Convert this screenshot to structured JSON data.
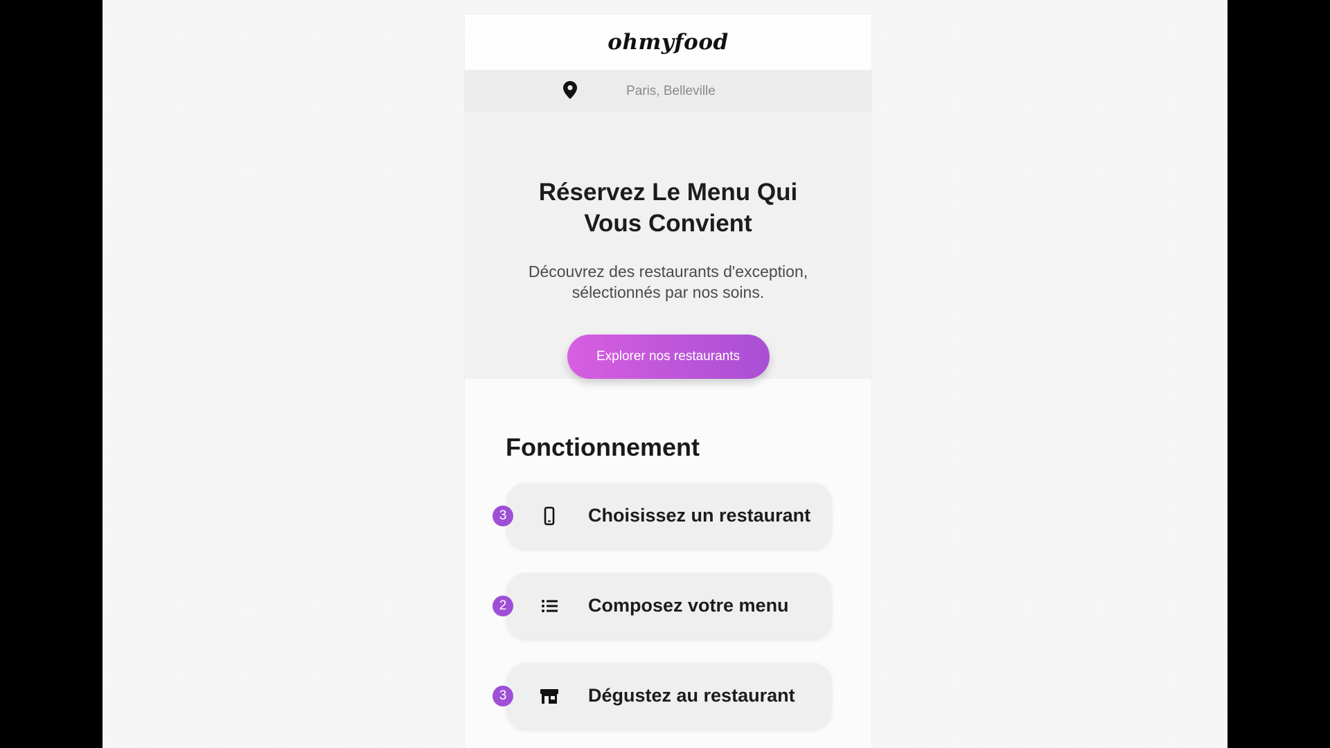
{
  "header": {
    "logo": "ohmyfood"
  },
  "location": {
    "icon": "map-pin-icon",
    "text": "Paris, Belleville"
  },
  "hero": {
    "title": "Réservez Le Menu Qui Vous Convient",
    "subtitle": "Découvrez des restaurants d'exception, sélectionnés par nos soins.",
    "cta_label": "Explorer nos restaurants"
  },
  "how_it_works": {
    "title": "Fonctionnement",
    "steps": [
      {
        "number": "3",
        "icon": "phone-icon",
        "label": "Choisissez un restaurant"
      },
      {
        "number": "2",
        "icon": "list-icon",
        "label": "Composez votre menu"
      },
      {
        "number": "3",
        "icon": "store-icon",
        "label": "Dégustez au restaurant"
      }
    ]
  },
  "colors": {
    "accent_start": "#d75ee0",
    "accent_end": "#a94fd4",
    "badge": "#9e4fd6",
    "location_bar": "#ececec",
    "hero_bg": "#f1f1f1"
  }
}
